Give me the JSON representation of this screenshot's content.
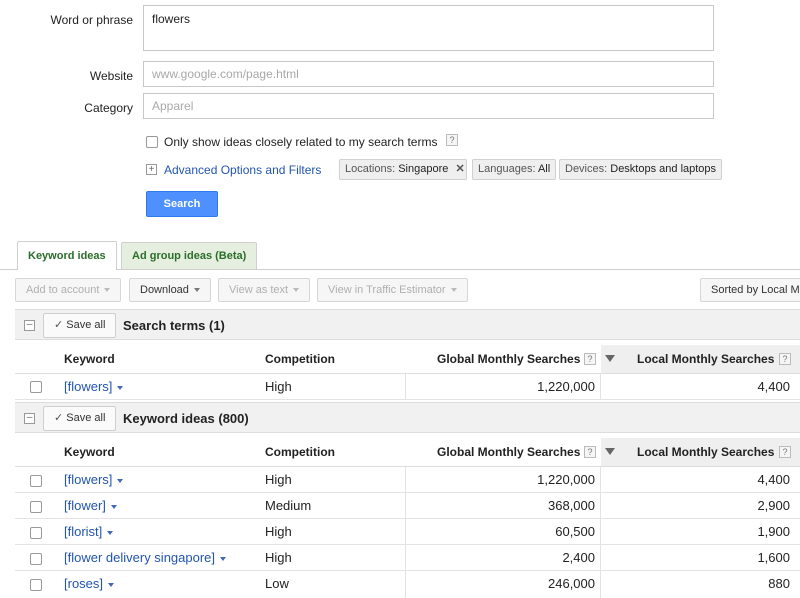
{
  "form": {
    "word_label": "Word or phrase",
    "word_value": "flowers",
    "website_label": "Website",
    "website_placeholder": "www.google.com/page.html",
    "category_label": "Category",
    "category_placeholder": "Apparel",
    "closely_related_label": "Only show ideas closely related to my search terms",
    "advanced_link": "Advanced Options and Filters",
    "chips": {
      "locations_key": "Locations:",
      "locations_val": "Singapore",
      "languages_key": "Languages:",
      "languages_val": "All",
      "devices_key": "Devices:",
      "devices_val": "Desktops and laptops"
    },
    "search_button": "Search"
  },
  "tabs": [
    "Keyword ideas",
    "Ad group ideas (Beta)"
  ],
  "toolbar": {
    "add_to_account": "Add to account",
    "download": "Download",
    "view_as_text": "View as text",
    "view_in_estimator": "View in Traffic Estimator",
    "sorted_by": "Sorted by Local M"
  },
  "columns": {
    "keyword": "Keyword",
    "competition": "Competition",
    "global": "Global Monthly Searches",
    "local": "Local Monthly Searches"
  },
  "save_all": "Save all",
  "search_terms": {
    "title": "Search terms (1)",
    "rows": [
      {
        "keyword": "[flowers]",
        "competition": "High",
        "global": "1,220,000",
        "local": "4,400"
      }
    ]
  },
  "keyword_ideas": {
    "title": "Keyword ideas (800)",
    "rows": [
      {
        "keyword": "[flowers]",
        "competition": "High",
        "global": "1,220,000",
        "local": "4,400"
      },
      {
        "keyword": "[flower]",
        "competition": "Medium",
        "global": "368,000",
        "local": "2,900"
      },
      {
        "keyword": "[florist]",
        "competition": "High",
        "global": "60,500",
        "local": "1,900"
      },
      {
        "keyword": "[flower delivery singapore]",
        "competition": "High",
        "global": "2,400",
        "local": "1,600"
      },
      {
        "keyword": "[roses]",
        "competition": "Low",
        "global": "246,000",
        "local": "880"
      }
    ]
  },
  "colors": {
    "link": "#2255b0",
    "search_button": "#4d90fe",
    "active_tab_text": "#2a6e2a"
  }
}
